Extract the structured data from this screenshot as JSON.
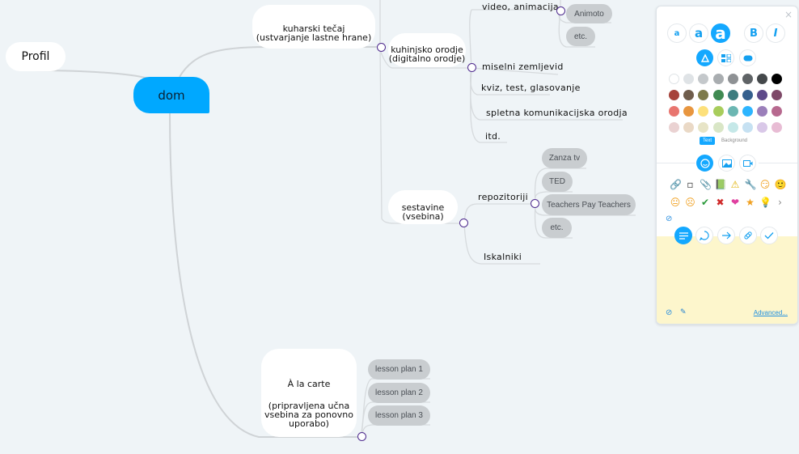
{
  "mindmap": {
    "root": "dom",
    "profil": "Profil",
    "kuharski": {
      "line1": "kuharski tečaj",
      "line2": "(ustvarjanje lastne hrane)"
    },
    "kuhinjsko": {
      "line1": "kuhinjsko orodje",
      "line2": "(digitalno orodje)"
    },
    "tools": [
      "video, animacija",
      "miselni zemljevid",
      "kviz, test, glasovanje",
      "spletna komunikacijska orodja",
      "itd."
    ],
    "video_children": [
      "Animoto",
      "etc."
    ],
    "sestavine": {
      "line1": "sestavine",
      "line2": "(vsebina)"
    },
    "sestavine_children": [
      "repozitoriji",
      "Iskalniki"
    ],
    "repozitoriji_children": [
      "Zanza tv",
      "TED",
      "Teachers Pay Teachers",
      "etc."
    ],
    "alacarte": {
      "title": "À la carte",
      "line1": "(pripravljena učna",
      "line2": "vsebina za ponovno",
      "line3": "uporabo)"
    },
    "lesson_plans": [
      "lesson plan 1",
      "lesson plan 2",
      "lesson plan 3"
    ]
  },
  "panel": {
    "close_icon": "×",
    "font_sizes": [
      "a",
      "a",
      "a"
    ],
    "bold": "B",
    "italic": "I",
    "shape_buttons": [
      "fill-icon",
      "layout-icon",
      "border-icon"
    ],
    "colors": [
      [
        "#ffffff",
        "#dfe3e6",
        "#c4c8cb",
        "#a9adb0",
        "#8e9194",
        "#5f6366",
        "#44484b",
        "#000000"
      ],
      [
        "#a6423a",
        "#6f5d4c",
        "#7d7a4b",
        "#408a52",
        "#3d7d7f",
        "#35608e",
        "#5e4a8a",
        "#7e4968"
      ],
      [
        "#e8756f",
        "#e8963f",
        "#fde07a",
        "#a8cd5c",
        "#6bb6b2",
        "#2db5ff",
        "#9b7fba",
        "#b7698f"
      ],
      [
        "#ead2d2",
        "#ead9c6",
        "#e7e4c6",
        "#d9e6c6",
        "#c5e8e8",
        "#c6e1f2",
        "#d9c8e8",
        "#e8bcd4"
      ]
    ],
    "tab_text": "Text",
    "tab_background": "Background",
    "media_tabs": [
      "emoji-icon",
      "image-icon",
      "video-icon"
    ],
    "icons_row1": [
      "🔗",
      "▫",
      "📎",
      "📗",
      "⚠",
      "🔧",
      "😏",
      "🙂"
    ],
    "icons_row2": [
      "😐",
      "☹",
      "✔",
      "✖",
      "❤",
      "★",
      "💡",
      "›"
    ],
    "none_icon": "⊘",
    "note_tabs": [
      "notes-icon",
      "comment-icon",
      "arrow-icon",
      "link-icon",
      "task-icon"
    ],
    "advanced": "Advanced..."
  }
}
